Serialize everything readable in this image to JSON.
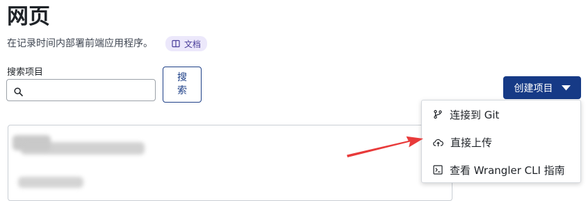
{
  "header": {
    "title": "网页",
    "subtitle": "在记录时间内部署前端应用程序。",
    "docs_label": "文档"
  },
  "search": {
    "label": "搜索项目",
    "placeholder": "",
    "value": "",
    "button_label": "搜索"
  },
  "create": {
    "button_label": "创建项目"
  },
  "dropdown": {
    "items": [
      {
        "label": "连接到 Git",
        "icon": "git-branch-icon"
      },
      {
        "label": "直接上传",
        "icon": "cloud-upload-icon"
      },
      {
        "label": "查看 Wrangler CLI 指南",
        "icon": "terminal-icon"
      }
    ]
  },
  "annotation": {
    "arrow_color": "#e83a3a"
  },
  "colors": {
    "primary": "#163a86",
    "badge_bg": "#ece8fb",
    "badge_text": "#4b3f9a"
  }
}
